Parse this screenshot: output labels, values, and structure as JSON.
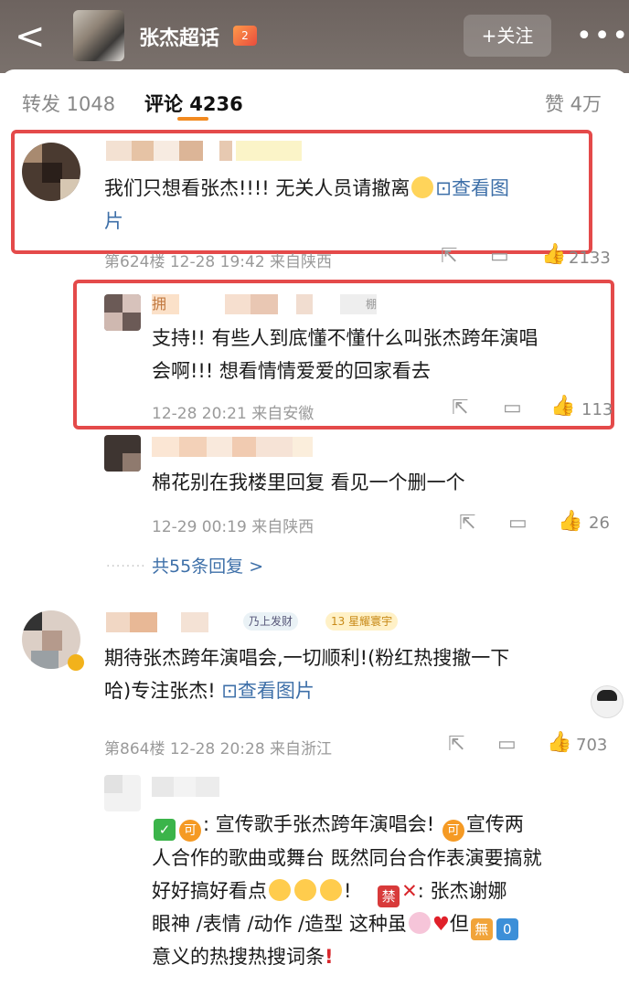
{
  "header": {
    "back": "<",
    "title": "张杰超话",
    "badge": "2",
    "follow": "+关注",
    "more": "•••"
  },
  "tabs": {
    "repost": "转发 1048",
    "comment": "评论 4236",
    "like": "赞 4万"
  },
  "c1": {
    "text": "我们只想看张杰!!!! 无关人员请撤离",
    "image_link": "查看图",
    "image_link_wrap": "片",
    "meta": "第624楼  12-28 19:42  来自陕西",
    "likes": "2133"
  },
  "r1": {
    "name_prefix": "拥",
    "name_suffix": "棚",
    "line1": "支持!! 有些人到底懂不懂什么叫张杰跨年演唱",
    "line2": "会啊!!!  想看情情爱爱的回家看去",
    "meta": "12-28 20:21  来自安徽",
    "likes": "113"
  },
  "r2": {
    "text": "棉花别在我楼里回复 看见一个删一个",
    "meta": "12-29 00:19  来自陕西",
    "likes": "26"
  },
  "more_replies": "共55条回复 >",
  "c2": {
    "tag1": "乃上发财",
    "tag2_num": "13",
    "tag2": "星耀寰宇",
    "line1": "期待张杰跨年演唱会,一切顺利!(粉红热搜撤一下",
    "line2_a": "哈)专注张杰!",
    "image_link": "查看图片",
    "meta": "第864楼  12-28 20:28  来自浙江",
    "likes": "703"
  },
  "r3": {
    "check": "✓",
    "ke": "可",
    "l1": ": 宣传歌手张杰跨年演唱会!",
    "l1b": "宣传两",
    "l2": "人合作的歌曲或舞台  既然同台合作表演要搞就",
    "l3a": "好好搞好看点",
    "l3b": "!",
    "jin": "禁",
    "cross": "✕",
    "l3c": ": 张杰谢娜",
    "l4a": "眼神 /表情 /动作 /造型 这种虽",
    "l4b": "但",
    "wu": "無",
    "zero": "0",
    "l5": "意义的热搜热搜词条",
    "excl": "!"
  },
  "icons": {
    "share": "⇱",
    "comment": "▭",
    "like": "👍"
  },
  "colors": {
    "accent": "#f28a20",
    "link": "#3d6fa8",
    "highlight": "#e44a4a"
  }
}
